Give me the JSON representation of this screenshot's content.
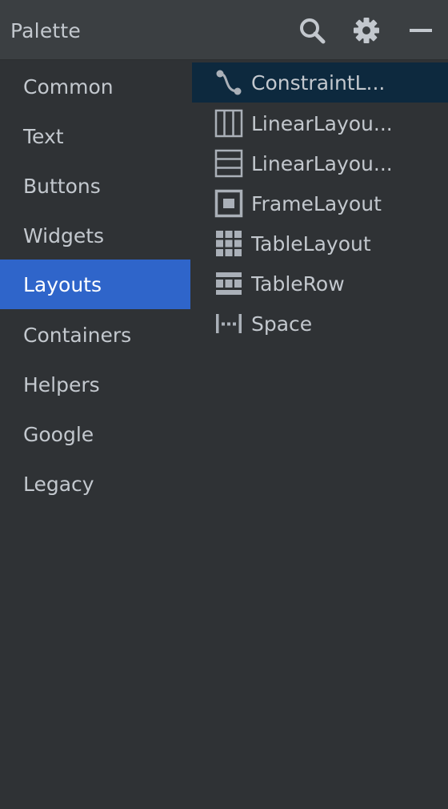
{
  "header": {
    "title": "Palette",
    "search_icon": "search-icon",
    "settings_icon": "gear-icon",
    "minimize_icon": "minimize-icon"
  },
  "categories": [
    {
      "label": "Common"
    },
    {
      "label": "Text"
    },
    {
      "label": "Buttons"
    },
    {
      "label": "Widgets"
    },
    {
      "label": "Layouts",
      "selected": true
    },
    {
      "label": "Containers"
    },
    {
      "label": "Helpers"
    },
    {
      "label": "Google"
    },
    {
      "label": "Legacy"
    }
  ],
  "components": [
    {
      "label": "ConstraintL...",
      "icon": "constraint-layout-icon",
      "selected": true
    },
    {
      "label": "LinearLayou...",
      "icon": "linear-layout-vertical-columns-icon"
    },
    {
      "label": "LinearLayou...",
      "icon": "linear-layout-horizontal-rows-icon"
    },
    {
      "label": "FrameLayout",
      "icon": "frame-layout-icon"
    },
    {
      "label": "TableLayout",
      "icon": "table-layout-icon"
    },
    {
      "label": "TableRow",
      "icon": "table-row-icon"
    },
    {
      "label": "Space",
      "icon": "space-icon"
    }
  ],
  "colors": {
    "background": "#2f3235",
    "header": "#3b3f42",
    "selected_category": "#2f65ca",
    "selected_component": "#0d293e",
    "icon": "#aab0b8"
  }
}
